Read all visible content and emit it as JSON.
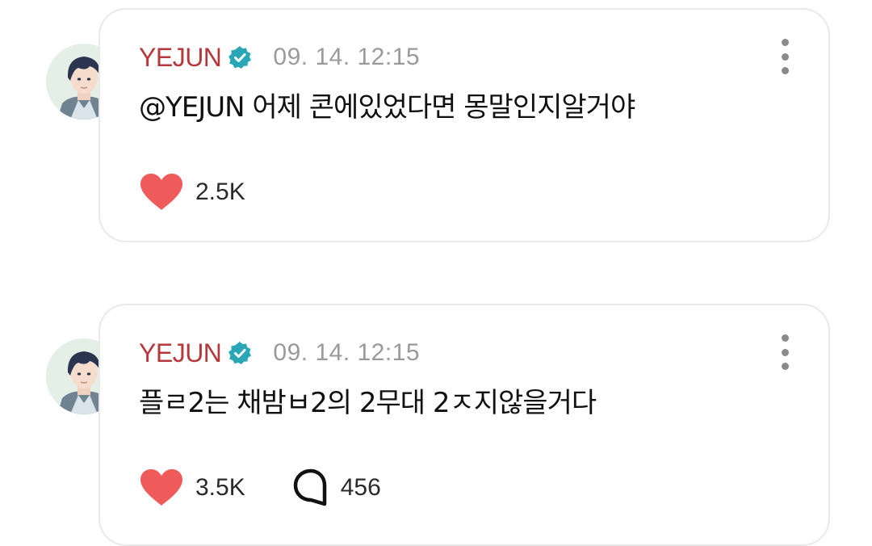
{
  "posts": [
    {
      "username": "YEJUN",
      "timestamp": "09. 14. 12:15",
      "content": "@YEJUN 어제 콘에있었다면 몽말인지알거야",
      "likes": "2.5K"
    },
    {
      "username": "YEJUN",
      "timestamp": "09. 14. 12:15",
      "content": "플ㄹ2는 채밤ㅂ2의 2무대 2ㅈ지않을거다",
      "likes": "3.5K",
      "comments": "456"
    }
  ],
  "colors": {
    "username": "#b5383d",
    "verified": "#2aa7b7",
    "heart": "#ef5a5a",
    "timestamp": "#9a9a9a",
    "card_border": "#e9e9e9"
  },
  "icons": {
    "verified": "verified-badge-icon",
    "more": "more-vertical-icon",
    "like": "heart-icon",
    "comment": "comment-bubble-icon"
  }
}
